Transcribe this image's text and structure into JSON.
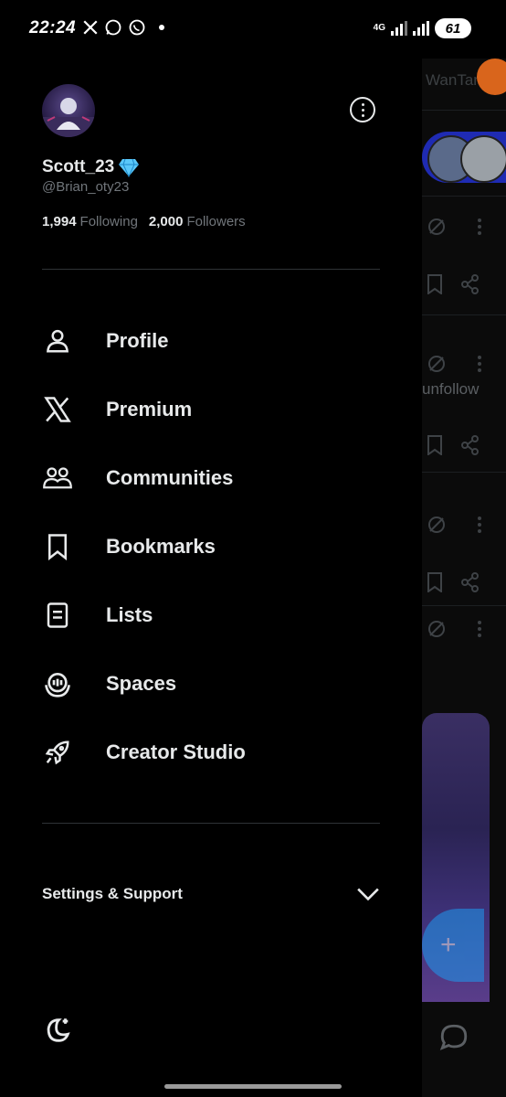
{
  "status_bar": {
    "time": "22:24",
    "network": "4G",
    "battery": "61"
  },
  "profile": {
    "display_name": "Scott_23",
    "handle": "@Brian_oty23",
    "following_count": "1,994",
    "following_label": "Following",
    "followers_count": "2,000",
    "followers_label": "Followers"
  },
  "menu": [
    {
      "label": "Profile",
      "icon": "person-icon"
    },
    {
      "label": "Premium",
      "icon": "x-logo-icon"
    },
    {
      "label": "Communities",
      "icon": "communities-icon"
    },
    {
      "label": "Bookmarks",
      "icon": "bookmark-icon"
    },
    {
      "label": "Lists",
      "icon": "list-icon"
    },
    {
      "label": "Spaces",
      "icon": "spaces-icon"
    },
    {
      "label": "Creator Studio",
      "icon": "rocket-icon"
    }
  ],
  "settings": {
    "label": "Settings & Support"
  },
  "timeline_peek": {
    "tab_text": "WanTan",
    "unfollow_text": "unfollow"
  },
  "colors": {
    "background": "#000000",
    "text": "#e7e9ea",
    "muted": "#71767b",
    "accent": "#1d9bf0",
    "verified_diamond": "#5ac8fa"
  }
}
